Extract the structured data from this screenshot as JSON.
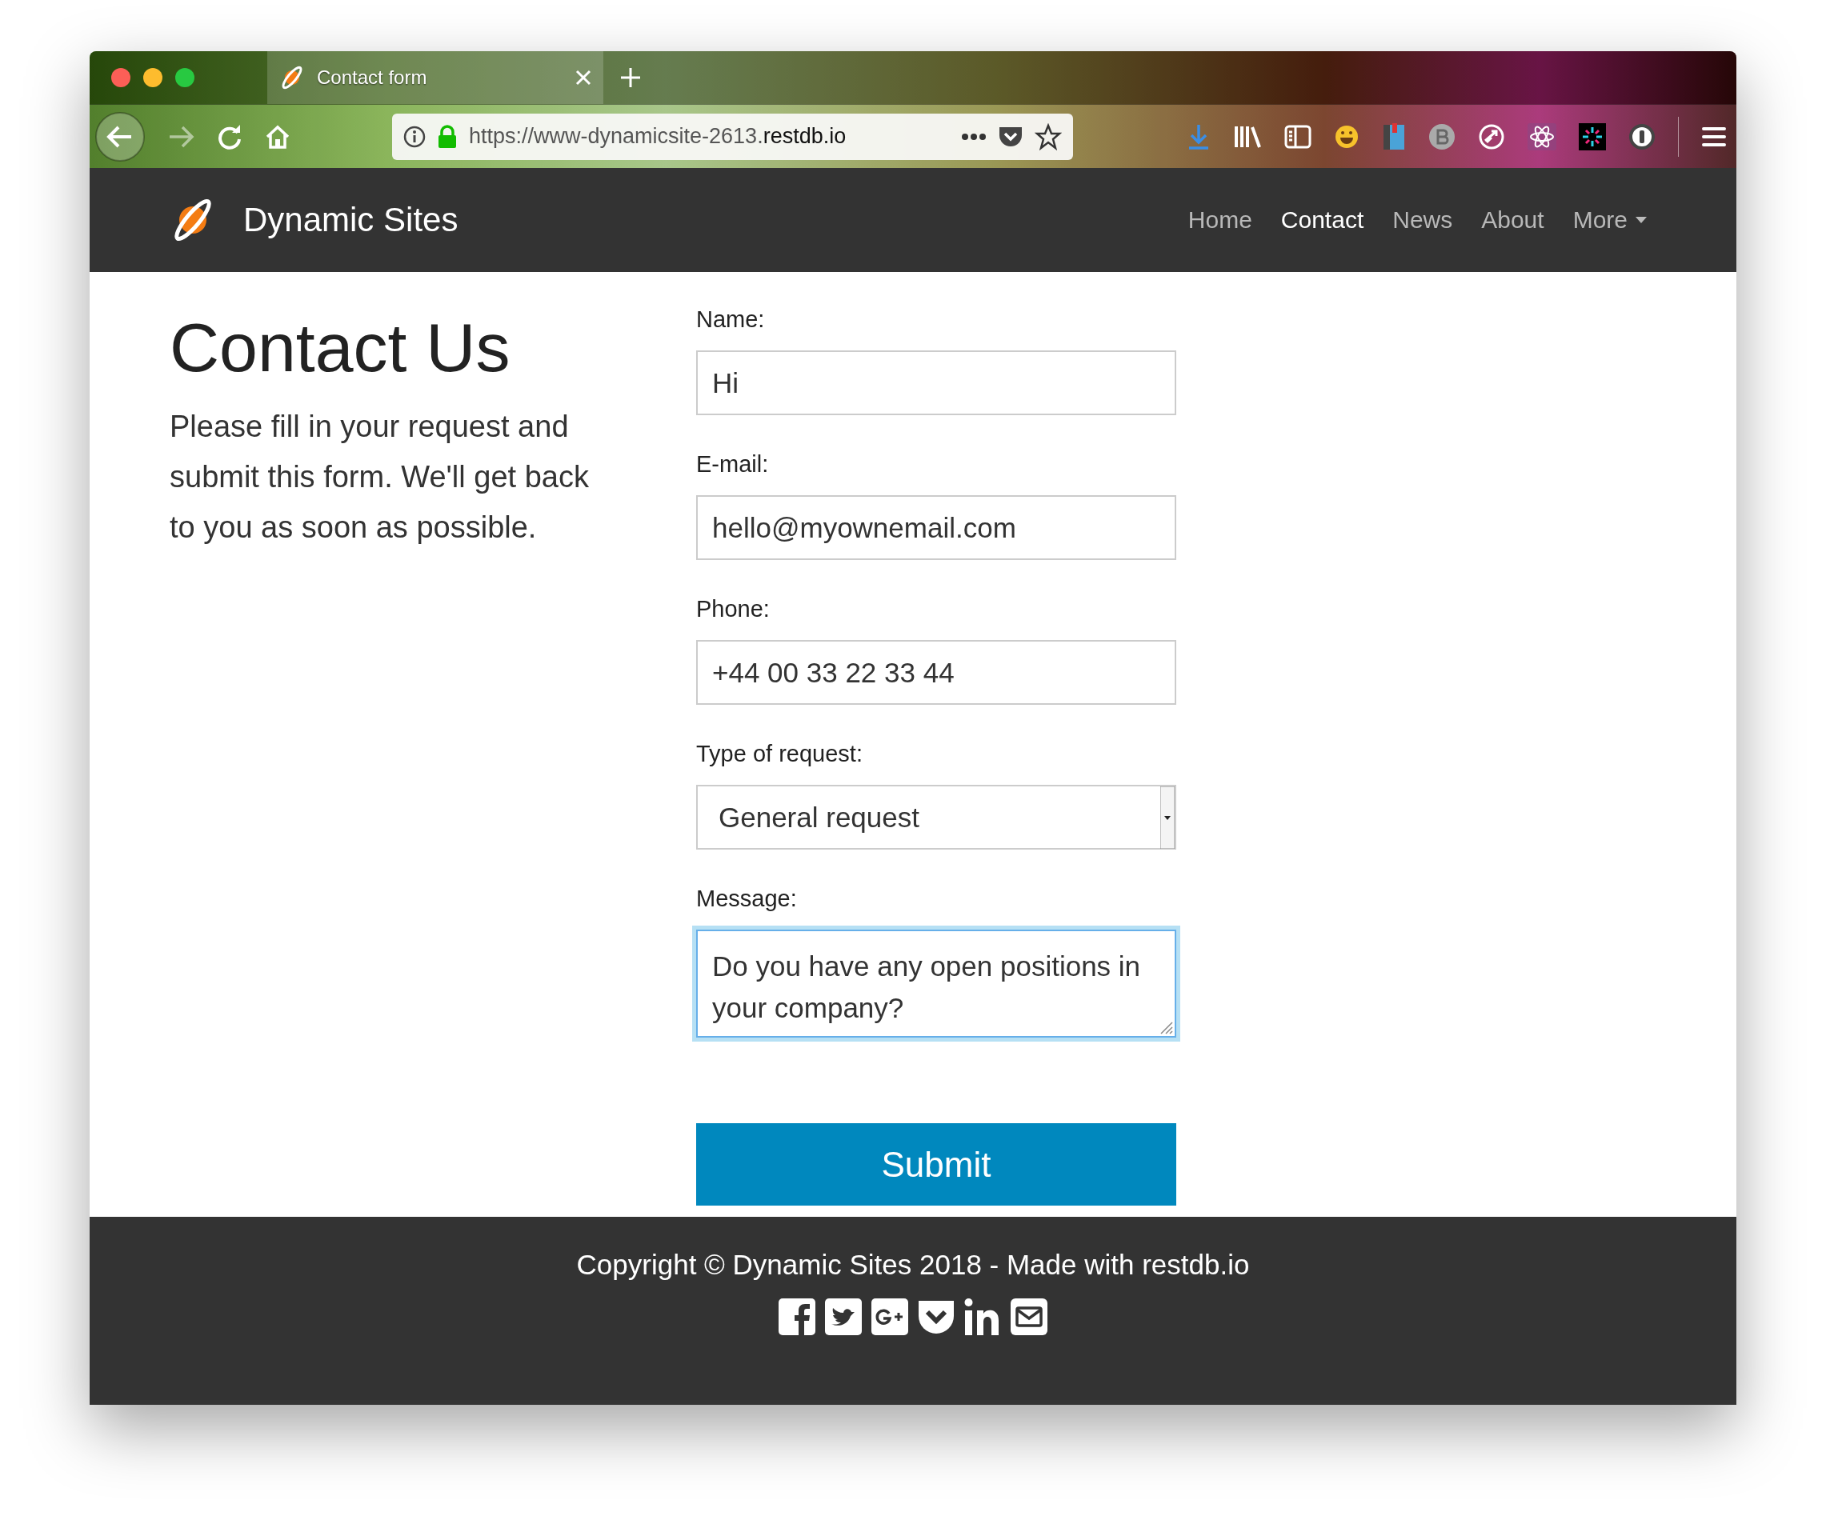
{
  "browser": {
    "tab_title": "Contact form",
    "url_prefix": "https://www-dynamicsite-2613.",
    "url_domain": "restdb.io"
  },
  "navbar": {
    "brand": "Dynamic Sites",
    "links": [
      {
        "label": "Home",
        "selected": false,
        "dropdown": false
      },
      {
        "label": "Contact",
        "selected": true,
        "dropdown": false
      },
      {
        "label": "News",
        "selected": false,
        "dropdown": false
      },
      {
        "label": "About",
        "selected": false,
        "dropdown": false
      },
      {
        "label": "More",
        "selected": false,
        "dropdown": true
      }
    ]
  },
  "intro": {
    "title": "Contact Us",
    "text": "Please fill in your request and submit this form. We'll get back to you as soon as possible."
  },
  "form": {
    "fields": [
      {
        "kind": "text",
        "label": "Name:",
        "value": "Hi",
        "focused": false
      },
      {
        "kind": "text",
        "label": "E-mail:",
        "value": "hello@myownemail.com",
        "focused": false
      },
      {
        "kind": "text",
        "label": "Phone:",
        "value": "+44 00 33 22 33 44",
        "focused": false
      },
      {
        "kind": "select",
        "label": "Type of request:",
        "value": "General request",
        "focused": false
      },
      {
        "kind": "textarea",
        "label": "Message:",
        "value": "Do you have any open positions in your company?",
        "focused": true
      }
    ],
    "submit": "Submit"
  },
  "footer": {
    "copyright": "Copyright © Dynamic Sites 2018 - Made with restdb.io",
    "social": [
      {
        "kind": "facebook"
      },
      {
        "kind": "twitter"
      },
      {
        "kind": "googleplus"
      },
      {
        "kind": "pocket"
      },
      {
        "kind": "linkedin"
      },
      {
        "kind": "email"
      }
    ]
  }
}
